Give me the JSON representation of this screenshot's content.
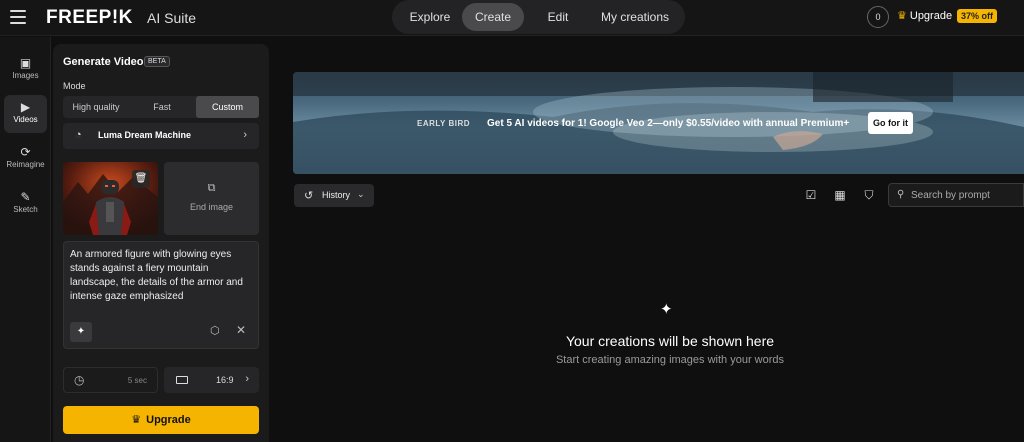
{
  "app": {
    "brand": "FREEP!K",
    "suite": "AI Suite"
  },
  "nav": {
    "items": [
      "Explore",
      "Create",
      "Edit",
      "My creations"
    ],
    "active": "Create"
  },
  "header_right": {
    "credits": "0",
    "upgrade_label": "Upgrade",
    "discount_badge": "37% off"
  },
  "rail": {
    "items": [
      {
        "label": "Images",
        "icon": "image-icon"
      },
      {
        "label": "Videos",
        "icon": "video-icon",
        "active": true
      },
      {
        "label": "Reimagine",
        "icon": "refresh-icon"
      },
      {
        "label": "Sketch",
        "icon": "brush-icon"
      }
    ]
  },
  "panel": {
    "title": "Generate Video",
    "badge": "BETA",
    "mode_label": "Mode",
    "modes": [
      "High quality",
      "Fast",
      "Custom"
    ],
    "active_mode": "Custom",
    "model": "Luma Dream Machine",
    "end_image_label": "End image",
    "prompt": "An armored figure with glowing eyes stands against a fiery mountain landscape, the details of the armor and intense gaze emphasized",
    "duration": "5 sec",
    "aspect_ratio": "16:9",
    "upgrade_button": "Upgrade"
  },
  "banner": {
    "tag": "EARLY BIRD",
    "text": "Get 5 AI videos for 1! Google Veo 2—only $0.55/video with annual Premium+",
    "cta": "Go for it"
  },
  "toolbar": {
    "history_label": "History",
    "search_placeholder": "Search by prompt"
  },
  "empty_state": {
    "title": "Your creations will be shown here",
    "subtitle": "Start creating amazing images with your words"
  },
  "colors": {
    "accent": "#f5b400",
    "background": "#0f0f10",
    "panel": "#1b1b1c"
  }
}
